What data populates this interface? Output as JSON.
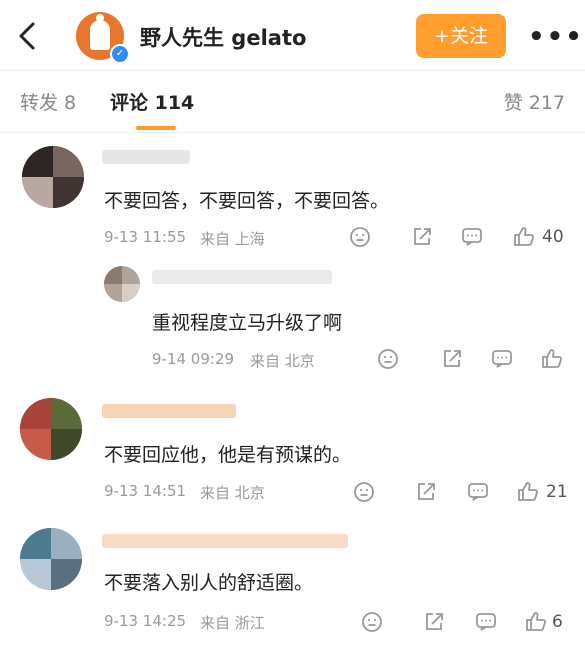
{
  "header": {
    "back_icon": "chevron-left-icon",
    "account_name": "野人先生 gelato",
    "verified_icon": "verified-badge-icon",
    "follow_label": "+关注",
    "more_label": "•••",
    "accent": "#ff9e2c"
  },
  "tabs": {
    "repost": "转发 8",
    "comment": "评论 114",
    "like": "赞 217"
  },
  "comments": [
    {
      "text": "不要回答，不要回答，不要回答。",
      "time": "9-13 11:55",
      "source": "来自 上海",
      "likes": "40"
    },
    {
      "text": "重视程度立马升级了啊",
      "time": "9-14 09:29",
      "source": "来自 北京",
      "likes": ""
    },
    {
      "text": "不要回应他，他是有预谋的。",
      "time": "9-13 14:51",
      "source": "来自 北京",
      "likes": "21"
    },
    {
      "text": "不要落入别人的舒适圈。",
      "time": "9-13 14:25",
      "source": "来自 浙江",
      "likes": "6"
    }
  ]
}
